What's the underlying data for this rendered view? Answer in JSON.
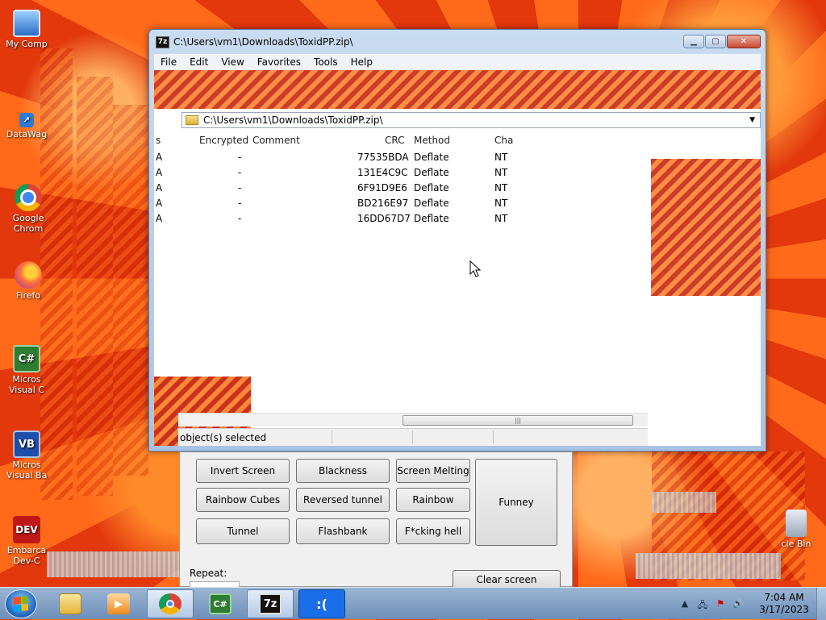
{
  "window": {
    "title": "C:\\Users\\vm1\\Downloads\\ToxidPP.zip\\",
    "app_badge": "7z",
    "menu": [
      "File",
      "Edit",
      "View",
      "Favorites",
      "Tools",
      "Help"
    ],
    "path": "C:\\Users\\vm1\\Downloads\\ToxidPP.zip\\",
    "columns": {
      "size_tail": "s",
      "encrypted": "Encrypted",
      "comment": "Comment",
      "crc": "CRC",
      "method": "Method",
      "characteristics": "Cha"
    },
    "rows": [
      {
        "attr": "A",
        "encrypted": "-",
        "crc": "77535BDA",
        "method": "Deflate",
        "char": "NT"
      },
      {
        "attr": "A",
        "encrypted": "-",
        "crc": "131E4C9C",
        "method": "Deflate",
        "char": "NT"
      },
      {
        "attr": "A",
        "encrypted": "-",
        "crc": "6F91D9E6",
        "method": "Deflate",
        "char": "NT"
      },
      {
        "attr": "A",
        "encrypted": "-",
        "crc": "BD216E97",
        "method": "Deflate",
        "char": "NT"
      },
      {
        "attr": "A",
        "encrypted": "-",
        "crc": "16DD67D7",
        "method": "Deflate",
        "char": "NT"
      }
    ],
    "status": "object(s) selected"
  },
  "panel": {
    "buttons": {
      "invert": "Invert Screen",
      "blackness": "Blackness",
      "melting": "Screen Melting",
      "funney": "Funney",
      "cubes": "Rainbow Cubes",
      "reversed": "Reversed tunnel",
      "rainbow": "Rainbow",
      "tunnel": "Tunnel",
      "flashbank": "Flashbank",
      "hell": "F*cking hell",
      "clear": "Clear screen"
    },
    "repeat_label": "Repeat:"
  },
  "desktop": {
    "icons": [
      {
        "label": "My Comp",
        "glyph": ""
      },
      {
        "label": "DataWag",
        "glyph": "↗"
      },
      {
        "label": "Google Chrom",
        "glyph": ""
      },
      {
        "label": "Firefo",
        "glyph": ""
      },
      {
        "label": "Micros Visual C",
        "glyph": "C#"
      },
      {
        "label": "Micros Visual Ba",
        "glyph": "VB"
      },
      {
        "label": "Embarca Dev-C",
        "glyph": "DEV"
      },
      {
        "label": "cle Bin",
        "glyph": ""
      }
    ]
  },
  "taskbar": {
    "apps": [
      {
        "name": "explorer",
        "glyph": ""
      },
      {
        "name": "media",
        "glyph": "▶"
      },
      {
        "name": "chrome",
        "glyph": ""
      },
      {
        "name": "csharp",
        "glyph": "C#"
      },
      {
        "name": "7zip",
        "glyph": "7z"
      },
      {
        "name": "sad",
        "glyph": ":("
      }
    ],
    "time": "7:04 AM",
    "date": "3/17/2023"
  },
  "colors": {
    "accent": "#1a73e8",
    "sad_blue": "#1a6fe8"
  }
}
